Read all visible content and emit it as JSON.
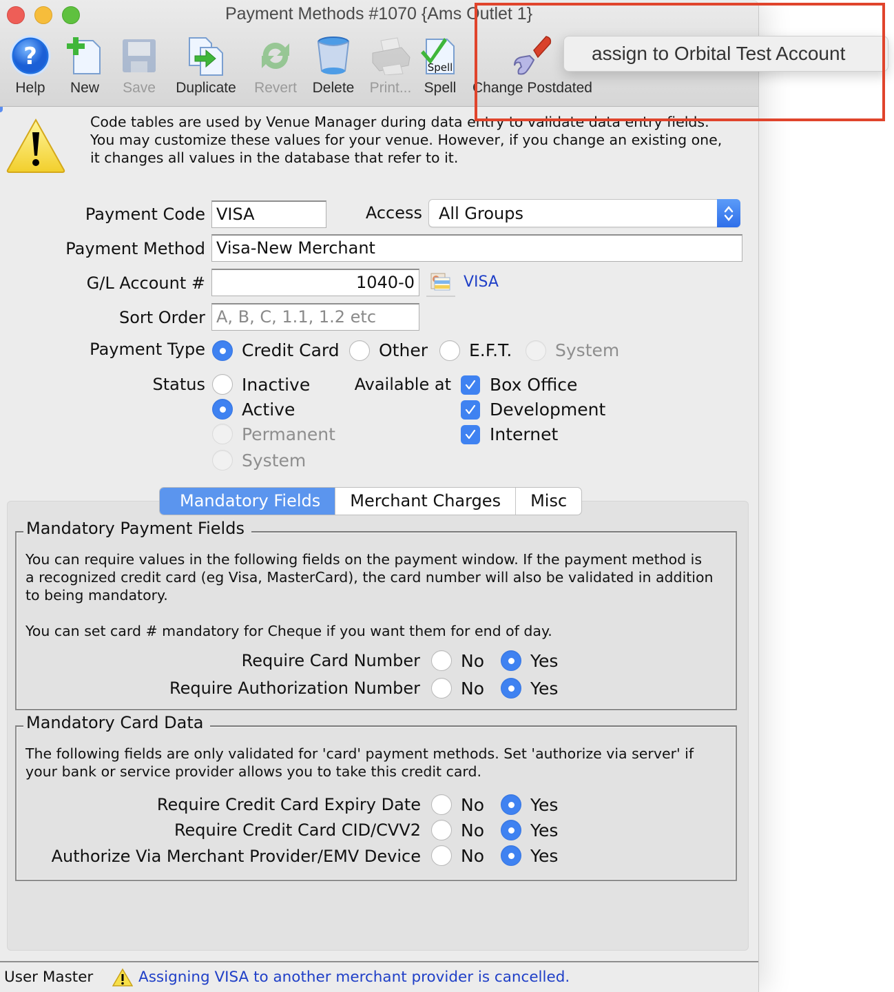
{
  "window": {
    "title": "Payment Methods  #1070 {Ams Outlet 1}"
  },
  "toolbar": {
    "items": [
      {
        "id": "help",
        "label": "Help",
        "icon": "help-icon",
        "enabled": true
      },
      {
        "id": "new",
        "label": "New",
        "icon": "new-document-icon",
        "enabled": true
      },
      {
        "id": "save",
        "label": "Save",
        "icon": "floppy-disk-icon",
        "enabled": false
      },
      {
        "id": "duplicate",
        "label": "Duplicate",
        "icon": "duplicate-icon",
        "enabled": true
      },
      {
        "id": "revert",
        "label": "Revert",
        "icon": "revert-icon",
        "enabled": false
      },
      {
        "id": "delete",
        "label": "Delete",
        "icon": "trash-icon",
        "enabled": true
      },
      {
        "id": "print",
        "label": "Print...",
        "icon": "printer-icon",
        "enabled": false
      },
      {
        "id": "spell",
        "label": "Spell",
        "icon": "spell-check-icon",
        "enabled": true
      },
      {
        "id": "change-postdated",
        "label": "Change Postdated",
        "icon": "wrench-icon",
        "enabled": true
      }
    ],
    "popup_menu": {
      "items": [
        "assign to  Orbital Test Account"
      ]
    }
  },
  "intro": {
    "text": "Code tables are used by Venue Manager during data entry to validate data entry fields.  You may customize these values for your venue.  However, if you change an existing one, it changes all values in the database that refer to it.",
    "lines": [
      "Code tables are used by Venue Manager during data entry to validate data entry fields.",
      "You may customize these values for your venue.  However, if you change an existing one,",
      "it changes all values in the database that refer to it."
    ]
  },
  "form": {
    "payment_code": {
      "label": "Payment Code",
      "value": "VISA"
    },
    "access": {
      "label": "Access",
      "value": "All Groups"
    },
    "payment_method": {
      "label": "Payment Method",
      "value": "Visa-New Merchant"
    },
    "gl_account": {
      "label": "G/L Account #",
      "value": "1040-0",
      "link": "VISA"
    },
    "sort_order": {
      "label": "Sort Order",
      "value": "",
      "placeholder": "A, B, C, 1.1, 1.2 etc"
    },
    "payment_type": {
      "label": "Payment Type",
      "options": [
        {
          "label": "Credit Card",
          "selected": true,
          "enabled": true
        },
        {
          "label": "Other",
          "selected": false,
          "enabled": true
        },
        {
          "label": "E.F.T.",
          "selected": false,
          "enabled": true
        },
        {
          "label": "System",
          "selected": false,
          "enabled": false
        }
      ]
    },
    "status": {
      "label": "Status",
      "options": [
        {
          "label": "Inactive",
          "selected": false,
          "enabled": true
        },
        {
          "label": "Active",
          "selected": true,
          "enabled": true
        },
        {
          "label": "Permanent",
          "selected": false,
          "enabled": false
        },
        {
          "label": "System",
          "selected": false,
          "enabled": false
        }
      ]
    },
    "available_at": {
      "label": "Available at",
      "options": [
        {
          "label": "Box Office",
          "checked": true
        },
        {
          "label": "Development",
          "checked": true
        },
        {
          "label": "Internet",
          "checked": true
        }
      ]
    }
  },
  "tabs": [
    {
      "label": "Mandatory Fields",
      "active": true
    },
    {
      "label": "Merchant Charges",
      "active": false
    },
    {
      "label": "Misc",
      "active": false
    }
  ],
  "mandatory_payment_fields": {
    "title": "Mandatory Payment Fields",
    "lines": [
      "You can require values in the following fields on the payment window.  If the payment method is",
      "a recognized credit card (eg Visa, MasterCard), the card number will also be validated in addition",
      "to being mandatory."
    ],
    "note": "You can set card # mandatory for Cheque if you want them for end of day.",
    "no_label": "No",
    "yes_label": "Yes",
    "rows": [
      {
        "label": "Require Card Number",
        "value": "Yes"
      },
      {
        "label": "Require Authorization Number",
        "value": "Yes"
      }
    ]
  },
  "mandatory_card_data": {
    "title": "Mandatory Card Data",
    "lines": [
      "The following fields are only validated for 'card' payment methods.  Set 'authorize via server' if",
      "your bank or service provider allows you to take this credit card."
    ],
    "no_label": "No",
    "yes_label": "Yes",
    "rows": [
      {
        "label": "Require Credit Card Expiry Date",
        "value": "Yes"
      },
      {
        "label": "Require Credit Card CID/CVV2",
        "value": "Yes"
      },
      {
        "label": "Authorize Via Merchant Provider/EMV Device",
        "value": "Yes"
      }
    ]
  },
  "statusbar": {
    "user": "User Master",
    "message": "Assigning VISA to another merchant provider is cancelled."
  },
  "colors": {
    "accent": "#3f82f1",
    "tab_active": "#5b95ee",
    "link": "#1f3fc7",
    "highlight_box": "#e0442c"
  }
}
